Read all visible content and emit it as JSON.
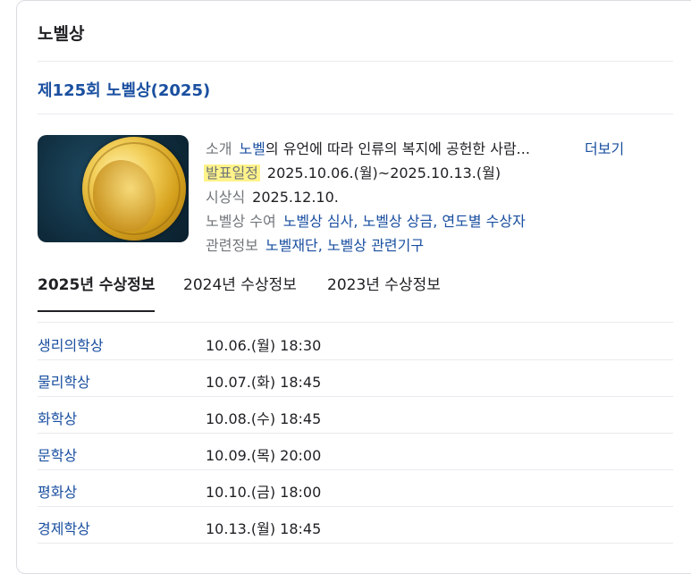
{
  "card": {
    "title": "노벨상"
  },
  "edition": {
    "title": "제125회 노벨상(2025)"
  },
  "info": {
    "intro": {
      "label": "소개",
      "link": "노벨",
      "text": "의 유언에 따라 인류의 복지에 공헌한 사람...",
      "more": "더보기"
    },
    "announce": {
      "label": "발표일정",
      "value": "2025.10.06.(월)~2025.10.13.(월)"
    },
    "ceremony": {
      "label": "시상식",
      "value": "2025.12.10."
    },
    "award": {
      "label": "노벨상 수여",
      "link1": "노벨상 심사",
      "link2": "노벨상 상금",
      "link3": "연도별 수상자"
    },
    "related": {
      "label": "관련정보",
      "link1": "노벨재단",
      "link2": "노벨상 관련기구"
    }
  },
  "tabs": [
    "2025년 수상정보",
    "2024년 수상정보",
    "2023년 수상정보"
  ],
  "prizes": [
    {
      "name": "생리의학상",
      "date": "10.06.(월) 18:30"
    },
    {
      "name": "물리학상",
      "date": "10.07.(화) 18:45"
    },
    {
      "name": "화학상",
      "date": "10.08.(수) 18:45"
    },
    {
      "name": "문학상",
      "date": "10.09.(목) 20:00"
    },
    {
      "name": "평화상",
      "date": "10.10.(금) 18:00"
    },
    {
      "name": "경제학상",
      "date": "10.13.(월) 18:45"
    }
  ]
}
